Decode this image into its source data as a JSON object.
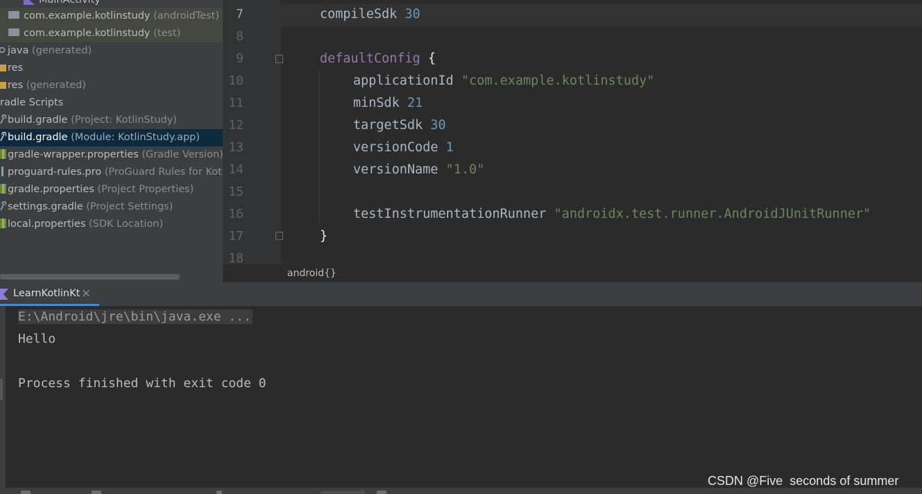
{
  "project_tree": {
    "rows": [
      {
        "name": "MainActivity",
        "hint": ""
      },
      {
        "name": "com.example.kotlinstudy",
        "hint": "(androidTest)"
      },
      {
        "name": "com.example.kotlinstudy",
        "hint": "(test)"
      },
      {
        "name": "java",
        "hint": "(generated)"
      },
      {
        "name": "res",
        "hint": ""
      },
      {
        "name": "res",
        "hint": "(generated)"
      },
      {
        "name": "radle Scripts",
        "hint": ""
      },
      {
        "name": "build.gradle",
        "hint": "(Project: KotlinStudy)"
      },
      {
        "name": "build.gradle",
        "hint": "(Module: KotlinStudy.app)"
      },
      {
        "name": "gradle-wrapper.properties",
        "hint": "(Gradle Version)"
      },
      {
        "name": "proguard-rules.pro",
        "hint": "(ProGuard Rules for KotlinS"
      },
      {
        "name": "gradle.properties",
        "hint": "(Project Properties)"
      },
      {
        "name": "settings.gradle",
        "hint": "(Project Settings)"
      },
      {
        "name": "local.properties",
        "hint": "(SDK Location)"
      }
    ]
  },
  "editor": {
    "line_numbers": [
      "7",
      "8",
      "9",
      "10",
      "11",
      "12",
      "13",
      "14",
      "15",
      "16",
      "17",
      "18"
    ],
    "lines": {
      "l7_key": "compileSdk",
      "l7_val": "30",
      "l9_key": "defaultConfig",
      "l9_brace": "{",
      "l10_key": "applicationId",
      "l10_val": "\"com.example.kotlinstudy\"",
      "l11_key": "minSdk",
      "l11_val": "21",
      "l12_key": "targetSdk",
      "l12_val": "30",
      "l13_key": "versionCode",
      "l13_val": "1",
      "l14_key": "versionName",
      "l14_val": "\"1.0\"",
      "l16_key": "testInstrumentationRunner",
      "l16_val": "\"androidx.test.runner.AndroidJUnitRunner\"",
      "l17_brace": "}"
    },
    "breadcrumb": "android{}"
  },
  "run_panel": {
    "tab_label": "LearnKotlinKt",
    "close_glyph": "×",
    "console": {
      "command": "E:\\Android\\jre\\bin\\java.exe ...",
      "output": "Hello",
      "exit_message": "Process finished with exit code 0"
    }
  },
  "watermark": "CSDN @Five  seconds of summer",
  "colors": {
    "panel_bg": "#3c3f41",
    "editor_bg": "#2b2b2b",
    "selection": "#0d293e",
    "number": "#6897bb",
    "string": "#6a8759",
    "keyword": "#9876aa",
    "tab_accent": "#4a88c7"
  }
}
